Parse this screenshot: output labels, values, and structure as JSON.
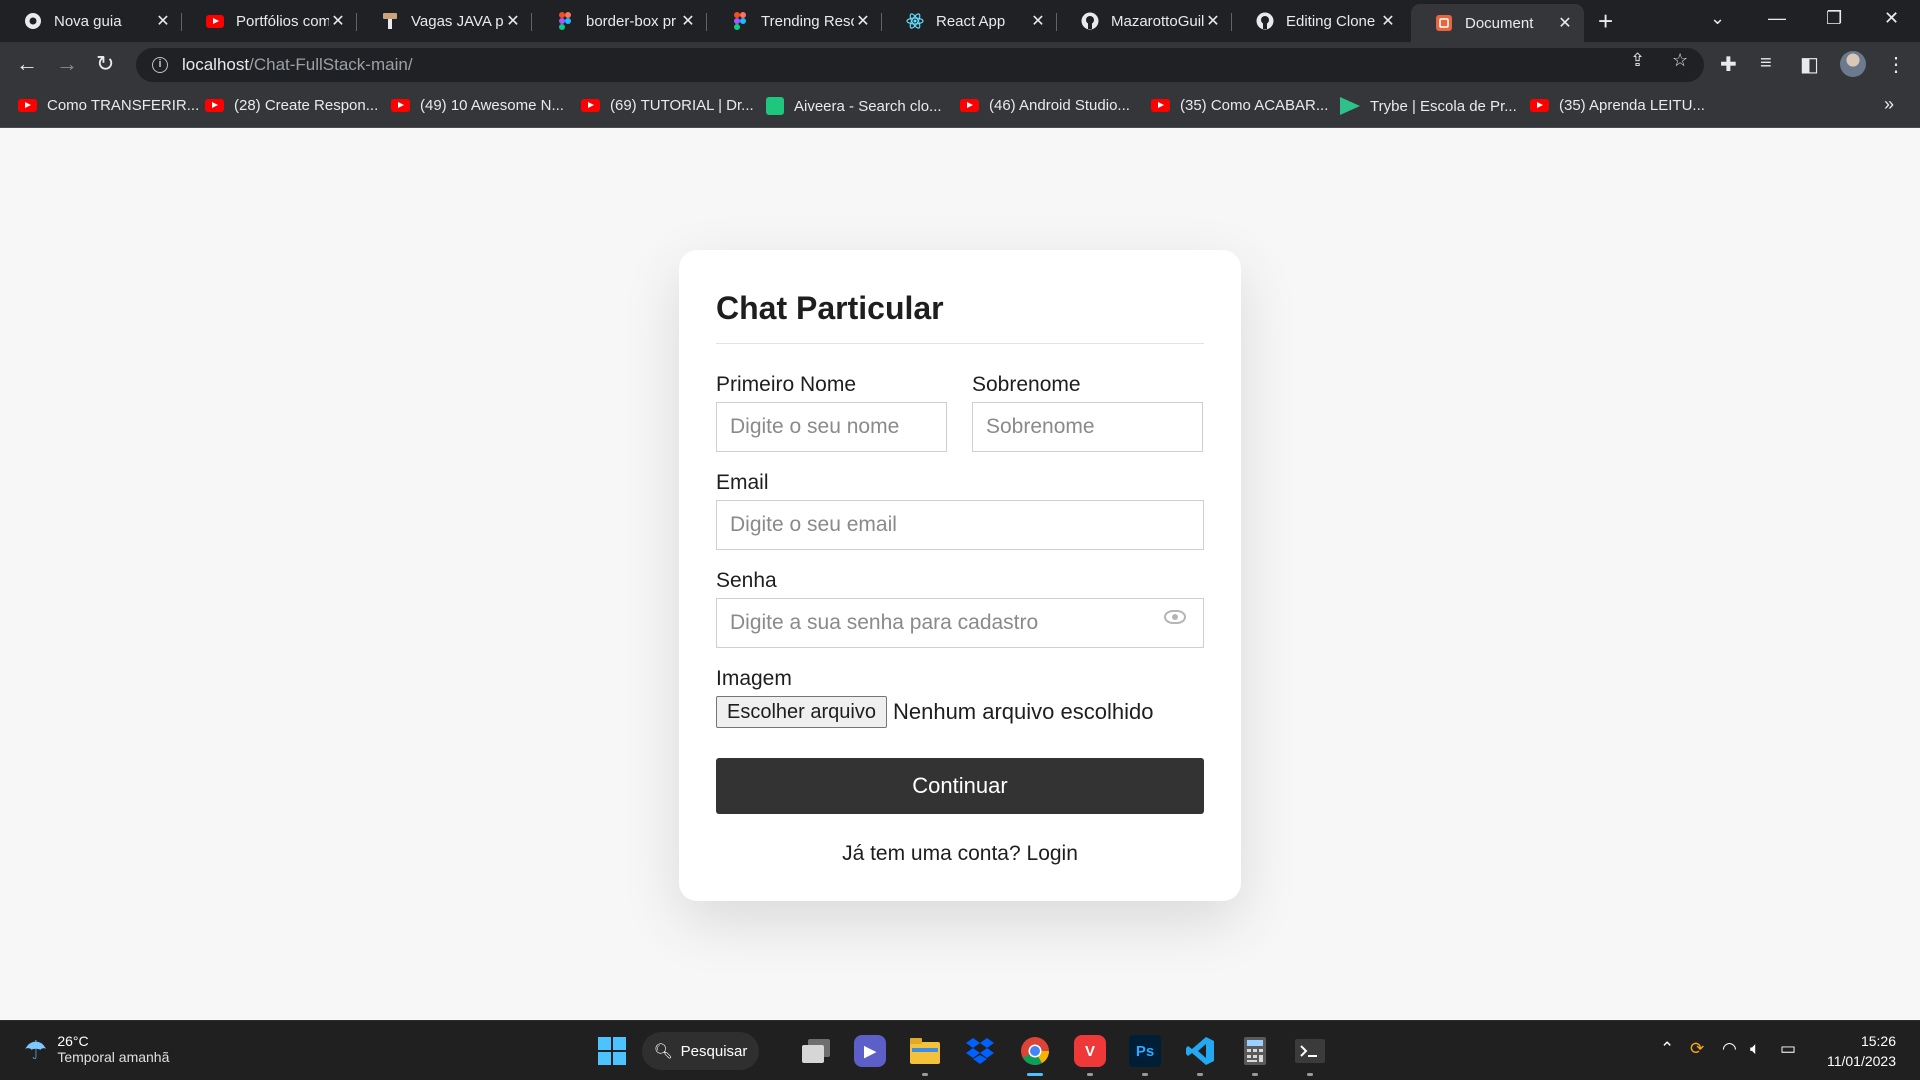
{
  "browser": {
    "tabs": [
      {
        "title": "Nova guia",
        "icon": "chrome-icon",
        "active": false
      },
      {
        "title": "Portfólios com",
        "icon": "youtube-icon",
        "active": false
      },
      {
        "title": "Vagas JAVA pa",
        "icon": "hammer-icon",
        "active": false
      },
      {
        "title": "border-box pr",
        "icon": "figma-icon",
        "active": false
      },
      {
        "title": "Trending Reso",
        "icon": "figma-icon",
        "active": false
      },
      {
        "title": "React App",
        "icon": "react-icon",
        "active": false
      },
      {
        "title": "MazarottoGuil",
        "icon": "github-icon",
        "active": false
      },
      {
        "title": "Editing Clone",
        "icon": "github-icon",
        "active": false
      },
      {
        "title": "Document",
        "icon": "html5-icon",
        "active": true
      }
    ],
    "url_host": "localhost",
    "url_path": "/Chat-FullStack-main/",
    "bookmarks": [
      {
        "label": "Como TRANSFERIR...",
        "icon": "youtube-icon"
      },
      {
        "label": "(28) Create Respon...",
        "icon": "youtube-icon"
      },
      {
        "label": "(49) 10 Awesome N...",
        "icon": "youtube-icon"
      },
      {
        "label": "(69) TUTORIAL | Dr...",
        "icon": "youtube-icon"
      },
      {
        "label": "Aiveera - Search clo...",
        "icon": "aiveera-icon"
      },
      {
        "label": "(46) Android Studio...",
        "icon": "youtube-icon"
      },
      {
        "label": "(35) Como ACABAR...",
        "icon": "youtube-icon"
      },
      {
        "label": "Trybe | Escola de Pr...",
        "icon": "trybe-icon"
      },
      {
        "label": "(35) Aprenda LEITU...",
        "icon": "youtube-icon"
      }
    ]
  },
  "form": {
    "title": "Chat Particular",
    "first_name_label": "Primeiro Nome",
    "first_name_placeholder": "Digite o seu nome",
    "last_name_label": "Sobrenome",
    "last_name_placeholder": "Sobrenome",
    "email_label": "Email",
    "email_placeholder": "Digite o seu email",
    "password_label": "Senha",
    "password_placeholder": "Digite a sua senha para cadastro",
    "image_label": "Imagem",
    "file_button": "Escolher arquivo",
    "file_status": "Nenhum arquivo escolhido",
    "submit_label": "Continuar",
    "footer_text": "Já tem uma conta?",
    "footer_link": "Login"
  },
  "taskbar": {
    "temperature": "26°C",
    "forecast": "Temporal amanhã",
    "search_label": "Pesquisar",
    "time": "15:26",
    "date": "11/01/2023"
  },
  "colors": {
    "button_bg": "#333333",
    "page_bg": "#f7f7f7",
    "active_indicator": "#4cc2ff"
  }
}
